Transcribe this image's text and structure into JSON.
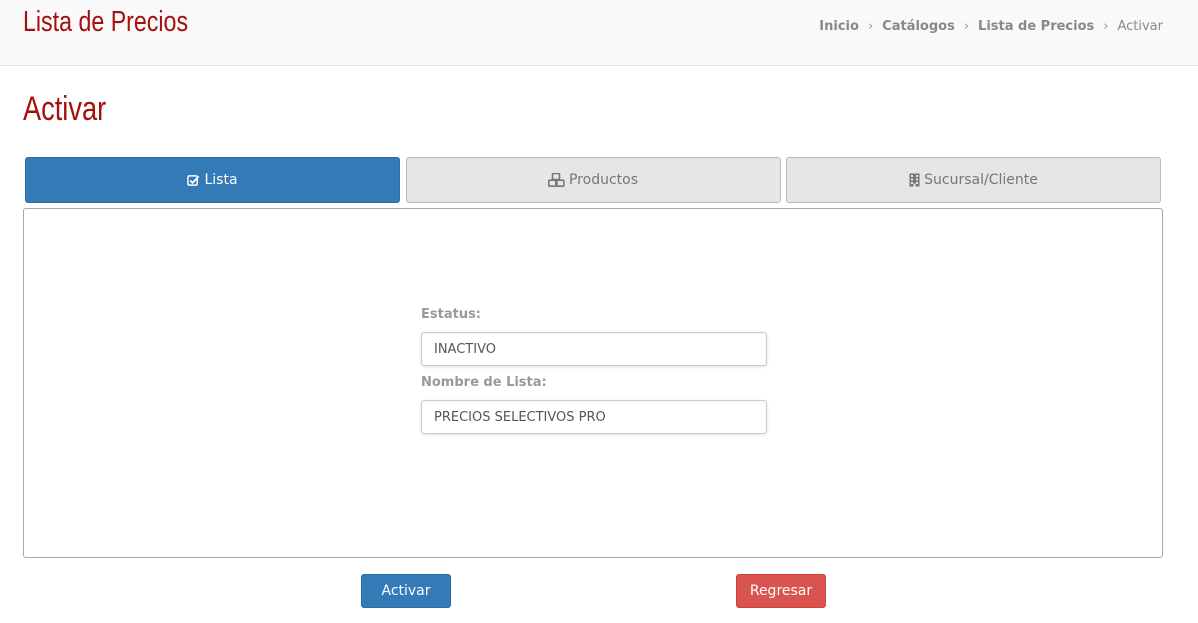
{
  "header": {
    "app_title": "Lista de Precios",
    "breadcrumb": {
      "items": [
        "Inicio",
        "Catálogos",
        "Lista de Precios"
      ],
      "current": "Activar"
    }
  },
  "page": {
    "title": "Activar"
  },
  "tabs": [
    {
      "label": "Lista",
      "icon": "check-square-icon",
      "active": true
    },
    {
      "label": "Productos",
      "icon": "cubes-icon",
      "active": false
    },
    {
      "label": "Sucursal/Cliente",
      "icon": "building-icon",
      "active": false
    }
  ],
  "form": {
    "estatus_label": "Estatus:",
    "estatus_value": "INACTIVO",
    "nombre_label": "Nombre de Lista:",
    "nombre_value": "PRECIOS SELECTIVOS PRO"
  },
  "buttons": {
    "activar": "Activar",
    "regresar": "Regresar"
  },
  "colors": {
    "brand": "#a50f0f",
    "primary": "#337ab7",
    "danger": "#d9534f"
  }
}
